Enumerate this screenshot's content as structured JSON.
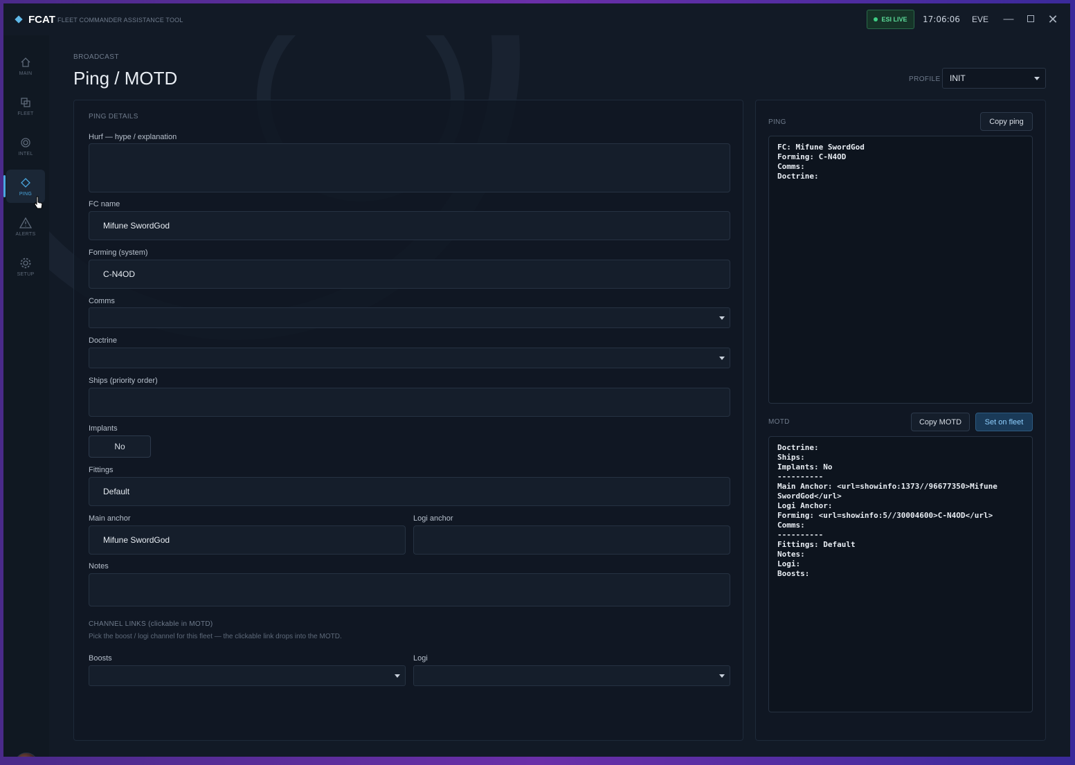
{
  "app": {
    "name": "FCAT",
    "subtitle": "FLEET COMMANDER ASSISTANCE TOOL",
    "esi_status": "ESI LIVE",
    "clock": "17:06:06",
    "server": "EVE",
    "accent": "#4aa8e0"
  },
  "sidebar": {
    "items": [
      {
        "label": "MAIN",
        "icon": "home-icon"
      },
      {
        "label": "FLEET",
        "icon": "fleet-icon"
      },
      {
        "label": "INTEL",
        "icon": "intel-icon"
      },
      {
        "label": "PING",
        "icon": "ping-icon",
        "active": true
      },
      {
        "label": "ALERTS",
        "icon": "alert-icon"
      },
      {
        "label": "SETUP",
        "icon": "gear-icon"
      }
    ]
  },
  "header": {
    "breadcrumb": "BROADCAST",
    "title": "Ping / MOTD",
    "profile_label": "PROFILE",
    "profile_value": "INIT"
  },
  "form": {
    "section_title": "PING DETAILS",
    "hurf_label": "Hurf — hype / explanation",
    "hurf_value": "",
    "fc_label": "FC name",
    "fc_value": "Mifune SwordGod",
    "forming_label": "Forming (system)",
    "forming_value": "C-N4OD",
    "comms_label": "Comms",
    "doctrine_label": "Doctrine",
    "ships_label": "Ships (priority order)",
    "implants_label": "Implants",
    "implants_value": "No",
    "fittings_label": "Fittings",
    "fittings_value": "Default",
    "main_anchor_label": "Main anchor",
    "main_anchor_value": "Mifune SwordGod",
    "logi_anchor_label": "Logi anchor",
    "notes_label": "Notes",
    "channel_links_title": "CHANNEL LINKS (clickable in MOTD)",
    "channel_links_hint": "Pick the boost / logi channel for this fleet — the clickable link drops into the MOTD.",
    "boosts_label": "Boosts",
    "logi_label": "Logi"
  },
  "ping": {
    "title": "PING",
    "copy_button": "Copy ping",
    "text": "FC: Mifune SwordGod\nForming: C-N4OD\nComms:\nDoctrine:"
  },
  "motd": {
    "title": "MOTD",
    "copy_button": "Copy MOTD",
    "set_button": "Set on fleet",
    "text": "Doctrine:\nShips:\nImplants: No\n----------\nMain Anchor: <url=showinfo:1373//96677350>Mifune SwordGod</url>\nLogi Anchor:\nForming: <url=showinfo:5//30004600>C-N4OD</url>\nComms:\n----------\nFittings: Default\nNotes:\nLogi:\nBoosts:"
  }
}
